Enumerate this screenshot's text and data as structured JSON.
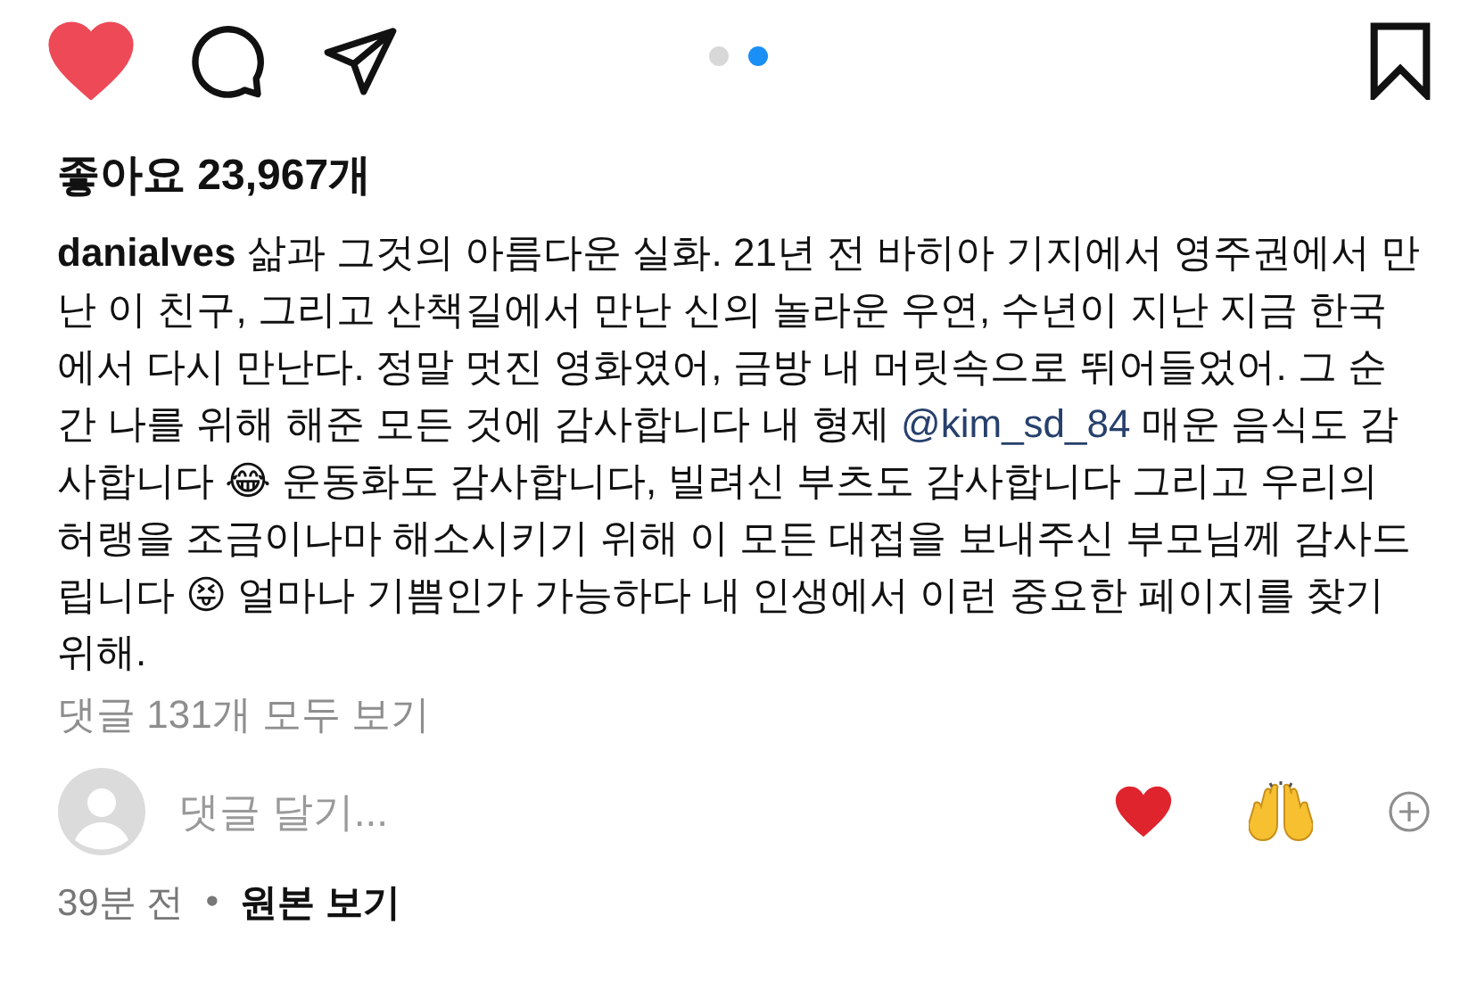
{
  "actions": {
    "liked": true,
    "saved": false
  },
  "carousel": [
    {
      "selected": false
    },
    {
      "selected": true
    }
  ],
  "likes": "좋아요 23,967개",
  "caption": {
    "username": "danialves",
    "parts": [
      {
        "kind": "text",
        "text": "삶과 그것의 아름다운 실화. 21년 전 바히아 기지에서 영주권에서 만난 이 친구, 그리고 산책길에서 만난 신의 놀라운 우연, 수년이 지난 지금 한국에서 다시 만난다. 정말 멋진 영화였어, 금방 내 머릿속으로 뛰어들었어. 그 순간 나를 위해 해준 모든 것에 감사합니다 내 형제 "
      },
      {
        "kind": "mention",
        "text": "@kim_sd_84"
      },
      {
        "kind": "text",
        "text": " 매운 음식도 감사합니다 😂 운동화도 감사합니다, 빌려신 부츠도 감사합니다 그리고 우리의 허랭을 조금이나마 해소시키기 위해 이 모든 대접을 보내주신 부모님께 감사드립니다 😝 얼마나 기쁨인가 가능하다 내 인생에서 이런 중요한 페이지를 찾기 위해."
      }
    ]
  },
  "view_comments": "댓글 131개 모두 보기",
  "comment_input": {
    "placeholder": "댓글 달기..."
  },
  "quick_reactions": [
    {
      "kind": "heart"
    },
    {
      "kind": "raised_hands"
    },
    {
      "kind": "add"
    }
  ],
  "time": "39분 전",
  "separator": "•",
  "see_original": "원본 보기"
}
